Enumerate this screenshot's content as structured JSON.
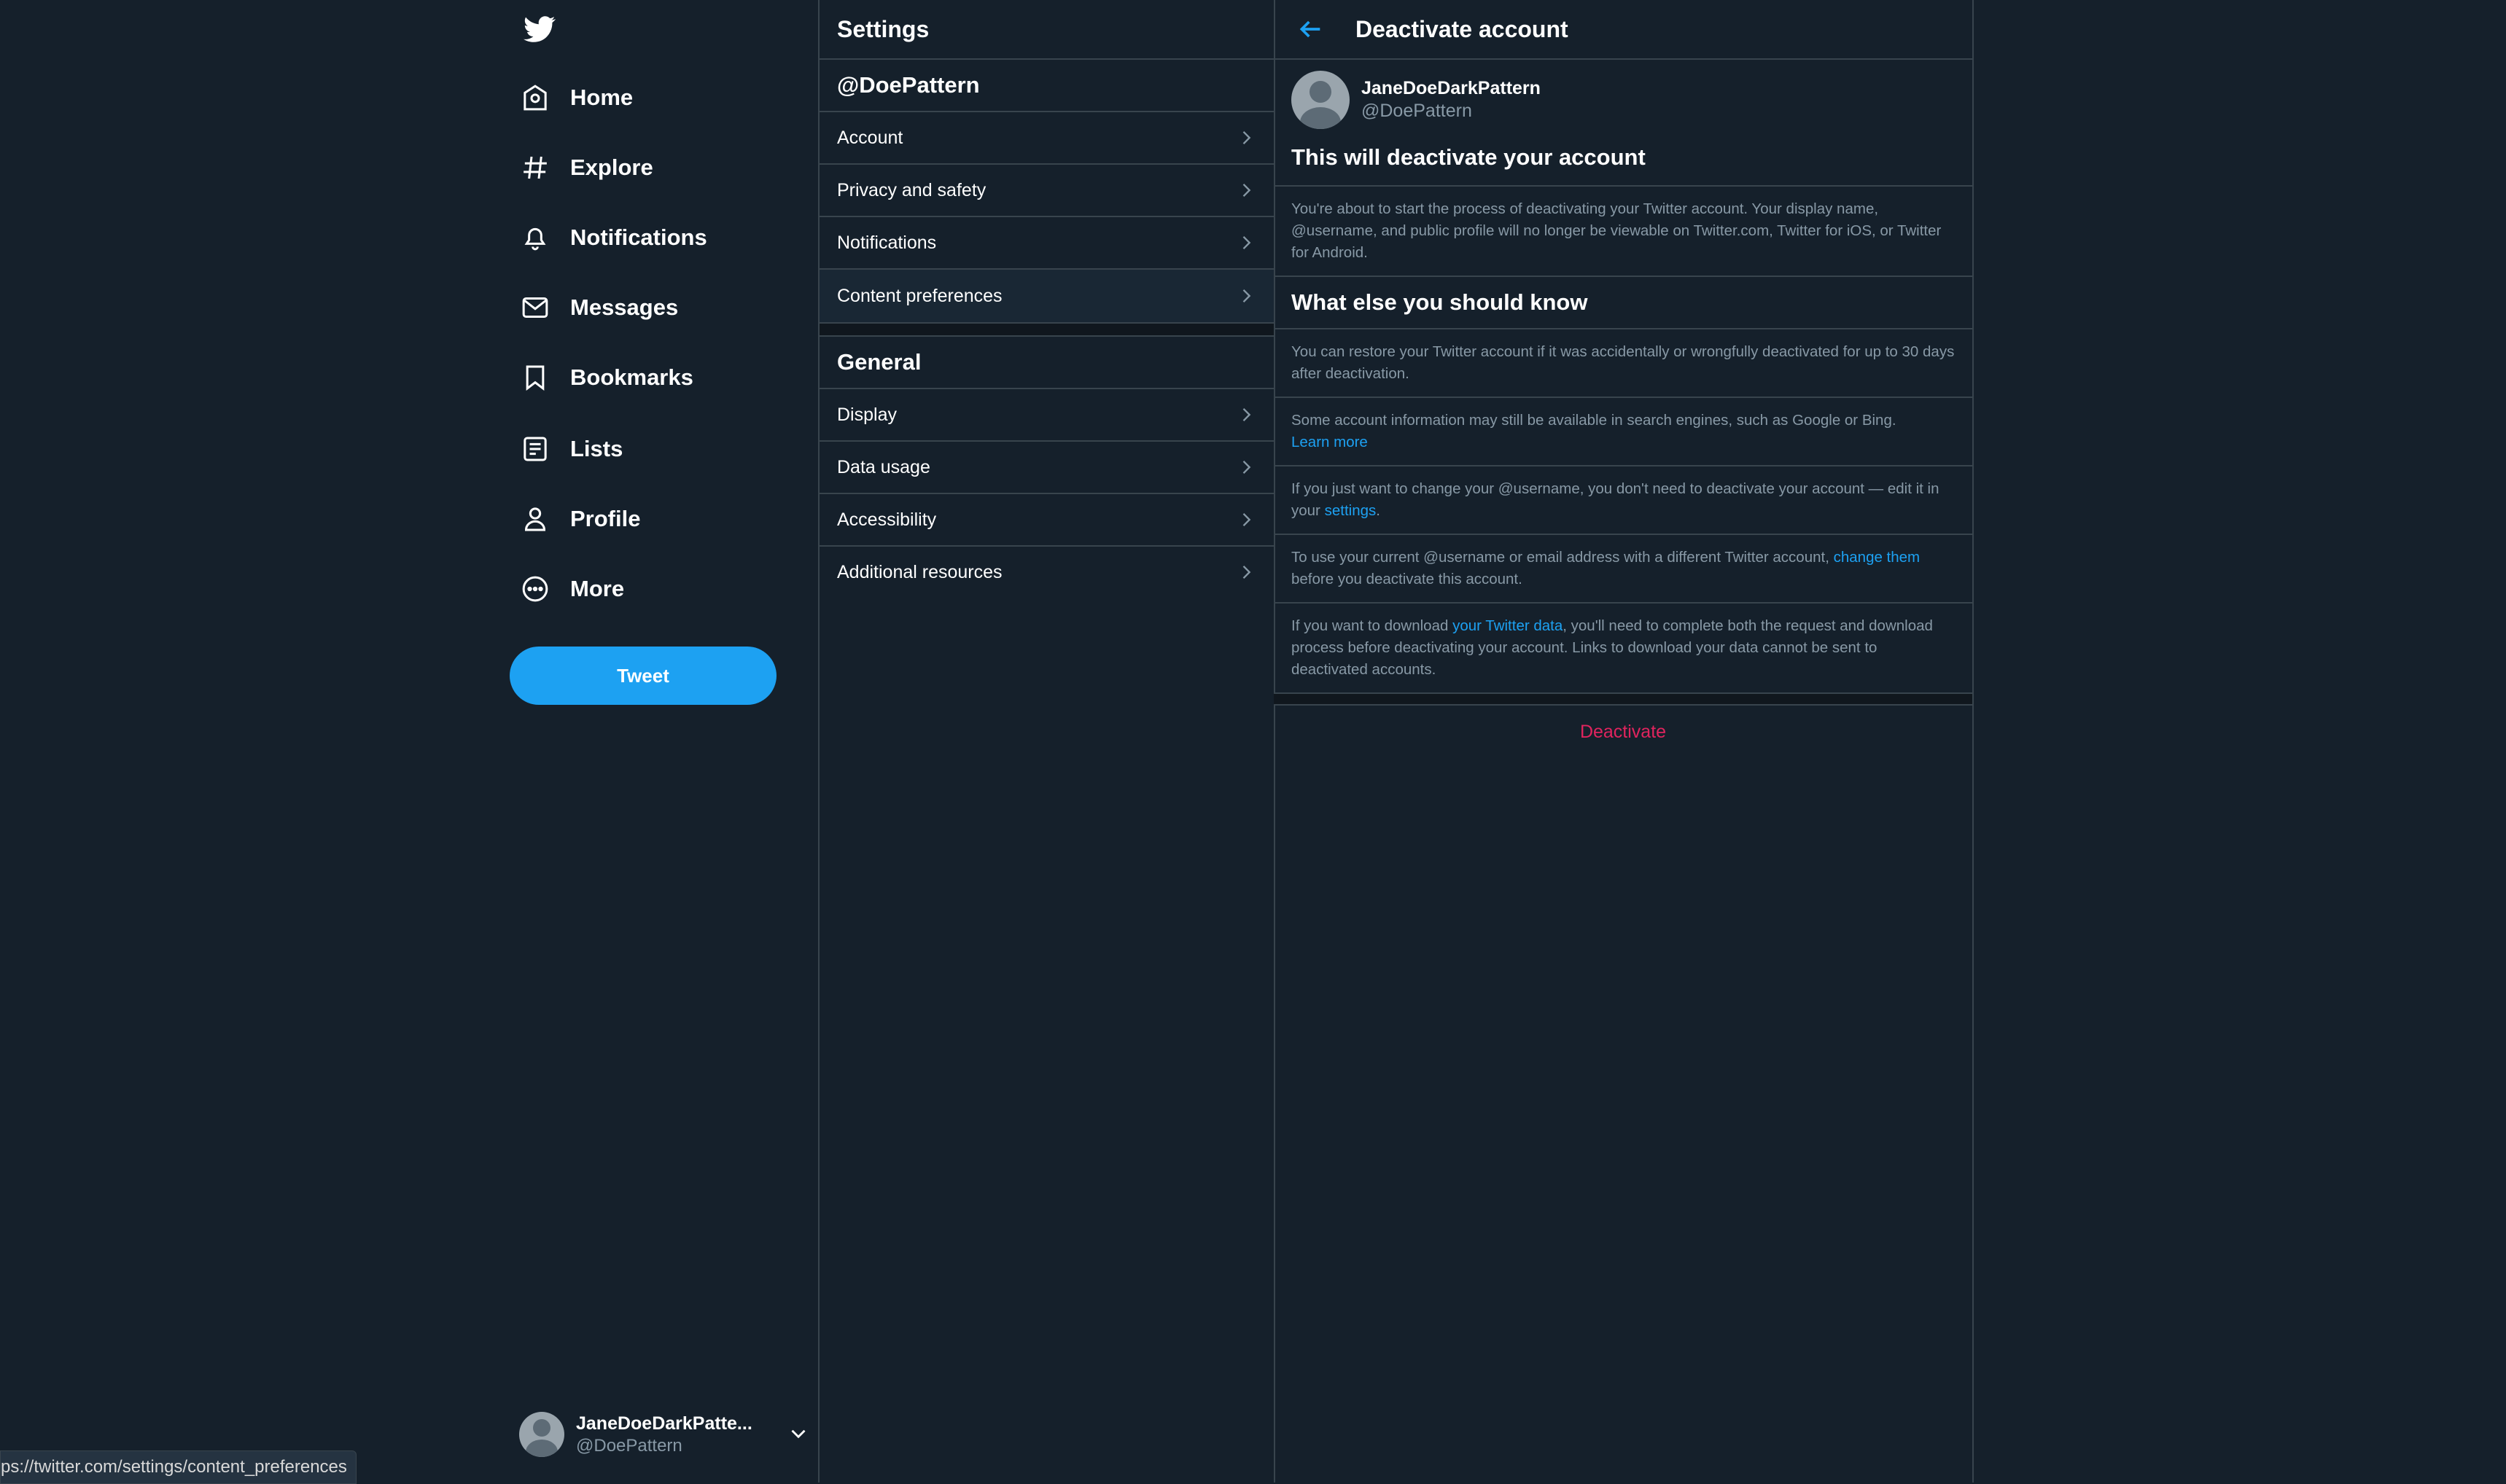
{
  "nav": {
    "items": [
      {
        "label": "Home",
        "icon": "home-icon"
      },
      {
        "label": "Explore",
        "icon": "hashtag-icon"
      },
      {
        "label": "Notifications",
        "icon": "bell-icon"
      },
      {
        "label": "Messages",
        "icon": "envelope-icon"
      },
      {
        "label": "Bookmarks",
        "icon": "bookmark-icon"
      },
      {
        "label": "Lists",
        "icon": "list-icon"
      },
      {
        "label": "Profile",
        "icon": "person-icon"
      },
      {
        "label": "More",
        "icon": "more-circle-icon"
      }
    ],
    "tweet_label": "Tweet",
    "account": {
      "name": "JaneDoeDarkPatte...",
      "handle": "@DoePattern"
    }
  },
  "status_url": "ps://twitter.com/settings/content_preferences",
  "settings": {
    "title": "Settings",
    "account_section": "@DoePattern",
    "account_items": [
      "Account",
      "Privacy and safety",
      "Notifications",
      "Content preferences"
    ],
    "general_section": "General",
    "general_items": [
      "Display",
      "Data usage",
      "Accessibility",
      "Additional resources"
    ]
  },
  "detail": {
    "title": "Deactivate account",
    "profile": {
      "name": "JaneDoeDarkPattern",
      "handle": "@DoePattern"
    },
    "heading1": "This will deactivate your account",
    "intro": "You're about to start the process of deactivating your Twitter account. Your display name, @username, and public profile will no longer be viewable on Twitter.com, Twitter for iOS, or Twitter for Android.",
    "heading2": "What else you should know",
    "p1": "You can restore your Twitter account if it was accidentally or wrongfully deactivated for up to 30 days after deactivation.",
    "p2_text": "Some account information may still be available in search engines, such as Google or Bing.",
    "p2_link": "Learn more",
    "p3_text": "If you just want to change your @username, you don't need to deactivate your account — edit it in your",
    "p3_link": "settings",
    "p3_end": ".",
    "p4_text": "To use your current @username or email address with a different Twitter account,",
    "p4_link": "change them",
    "p4_end": "before you deactivate this account.",
    "p5_text": "If you want to download",
    "p5_link": "your Twitter data",
    "p5_end": ", you'll need to complete both the request and download process before deactivating your account. Links to download your data cannot be sent to deactivated accounts.",
    "deactivate_label": "Deactivate"
  },
  "colors": {
    "background": "#15202b",
    "accent": "#1da1f2",
    "danger": "#e0245e",
    "muted": "#8899a6",
    "border": "#38444d"
  }
}
